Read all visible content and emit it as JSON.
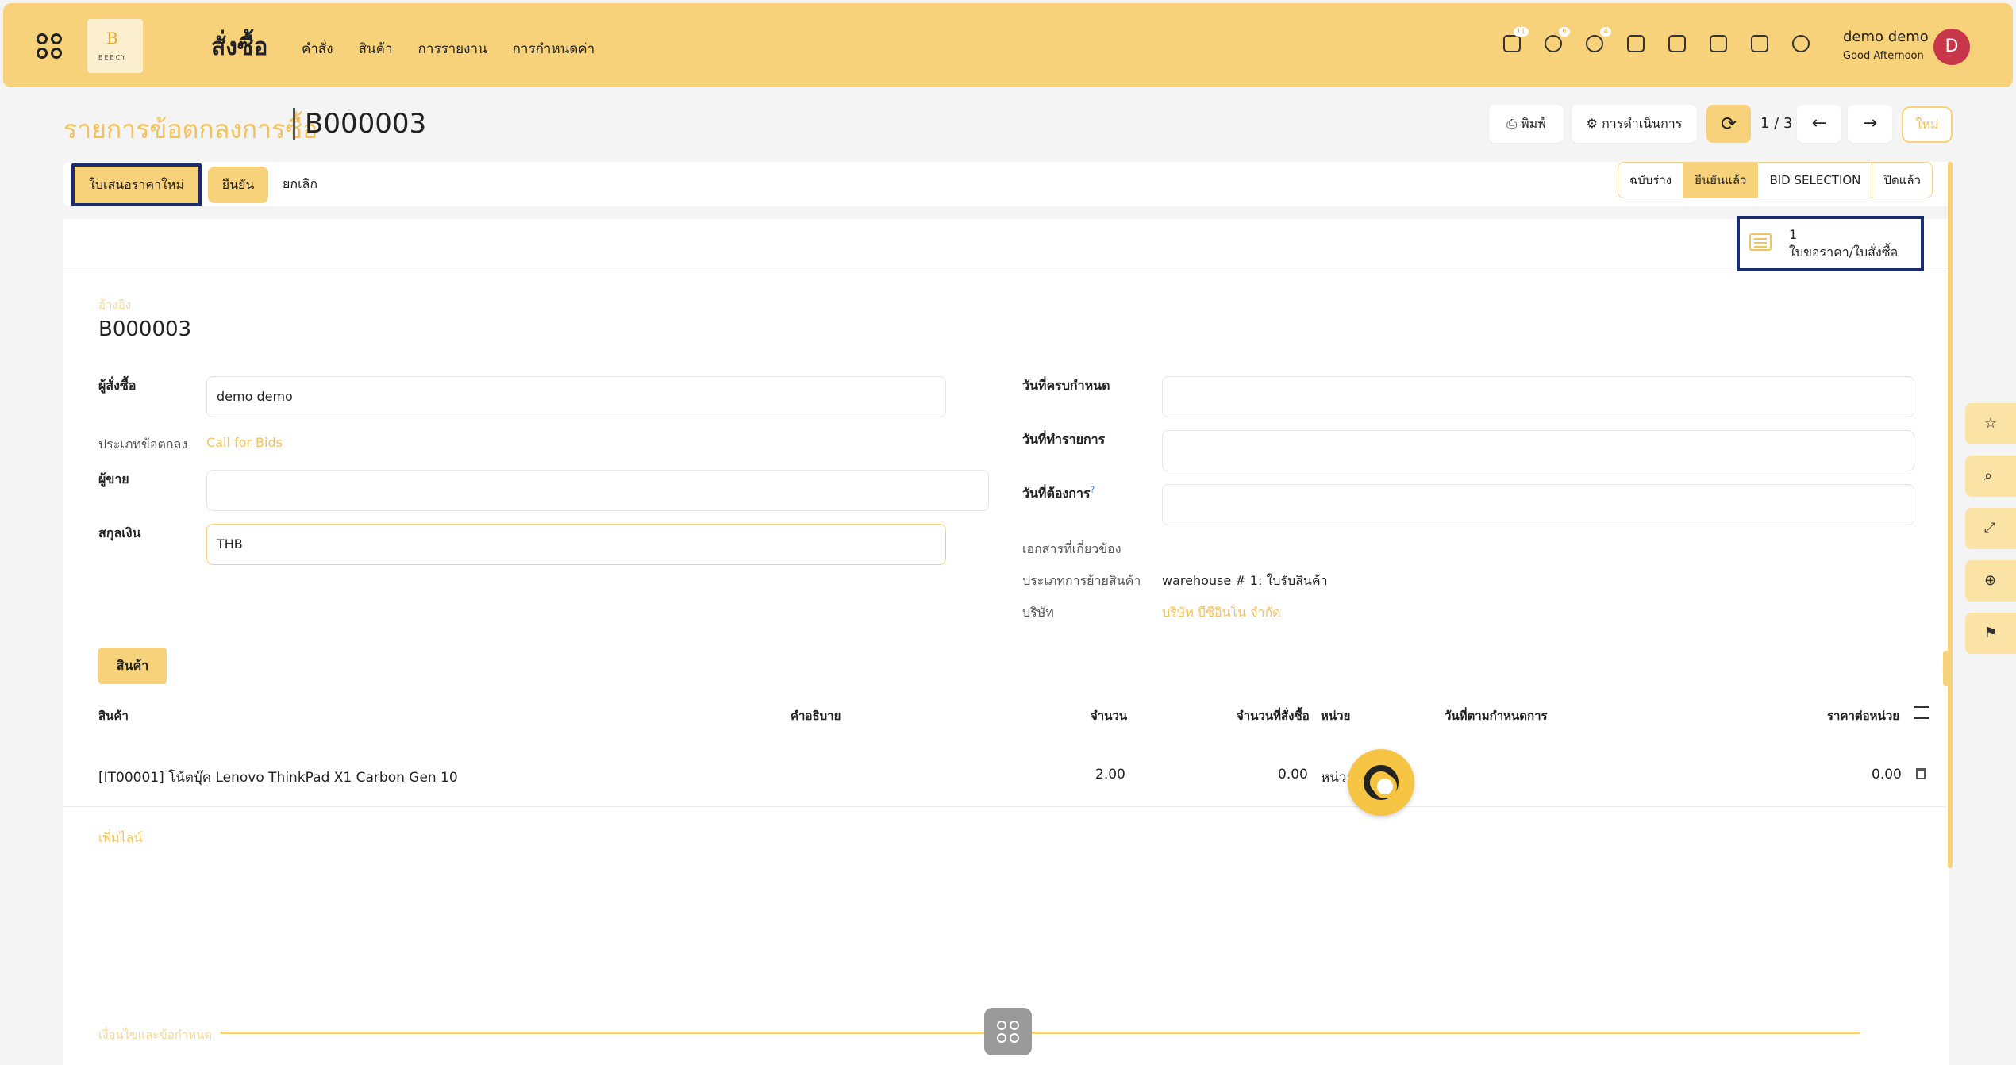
{
  "navbar": {
    "app_title": "สั่งซื้อ",
    "logo_letter": "B",
    "logo_text": "BEECY",
    "menu": [
      "คำสั่ง",
      "สินค้า",
      "การรายงาน",
      "การกำหนดค่า"
    ],
    "badges": {
      "activity": "11",
      "messages": "6",
      "timer": "4"
    },
    "user_name": "demo demo",
    "greeting": "Good Afternoon",
    "avatar_letter": "D"
  },
  "control": {
    "breadcrumb": "รายการข้อตกลงการซื้อ",
    "record": "B000003",
    "print": "พิมพ์",
    "actions": "การดำเนินการ",
    "pager": "1 / 3",
    "prev": "←",
    "next": "→",
    "new": "ใหม่"
  },
  "statusbar": {
    "new_quotation": "ใบเสนอราคาใหม่",
    "confirm": "ยืนยัน",
    "cancel": "ยกเลิก",
    "stages": [
      "ฉบับร่าง",
      "ยืนยันแล้ว",
      "BID SELECTION",
      "ปิดแล้ว"
    ],
    "active_stage": "ยืนยันแล้ว"
  },
  "smart_button": {
    "value": "1",
    "label": "ใบขอราคา/ใบสั่งซื้อ"
  },
  "form": {
    "ref_label": "อ้างอิง",
    "ref_value": "B000003",
    "purchaser_label": "ผู้สั่งซื้อ",
    "purchaser_value": "demo demo",
    "agreement_type_label": "ประเภทข้อตกลง",
    "agreement_type_value": "Call for Bids",
    "vendor_label": "ผู้ขาย",
    "vendor_value": "",
    "currency_label": "สกุลเงิน",
    "currency_value": "THB",
    "deadline_label": "วันที่ครบกำหนด",
    "deadline_value": "",
    "ordering_date_label": "วันที่ทำรายการ",
    "ordering_date_value": "",
    "schedule_date_label": "วันที่ต้องการ",
    "help_mark": "?",
    "schedule_date_value": "",
    "source_doc_label": "เอกสารที่เกี่ยวข้อง",
    "picking_type_label": "ประเภทการย้ายสินค้า",
    "picking_type_value": "warehouse # 1: ใบรับสินค้า",
    "company_label": "บริษัท",
    "company_value": "บริษัท บีซีอินโน จำกัด"
  },
  "products": {
    "tab": "สินค้า",
    "columns": [
      "สินค้า",
      "คำอธิบาย",
      "จำนวน",
      "จำนวนที่สั่งซื้อ",
      "หน่วย",
      "วันที่ตามกำหนดการ",
      "ราคาต่อหน่วย"
    ],
    "rows": [
      {
        "product": "[IT00001] โน้ตบุ๊ค Lenovo ThinkPad X1 Carbon Gen 10",
        "description": "",
        "qty": "2.00",
        "ordered": "0.00",
        "uom": "หน่วย",
        "scheduled": "",
        "price": "0.00"
      }
    ],
    "add_line": "เพิ่มไลน์"
  },
  "terms_label": "เงื่อนไขและข้อกำหนด",
  "colors": {
    "primary": "#f7d27b",
    "accent": "#f2c25e",
    "highlight_border": "#1a2d6b",
    "avatar": "#c8364a"
  }
}
